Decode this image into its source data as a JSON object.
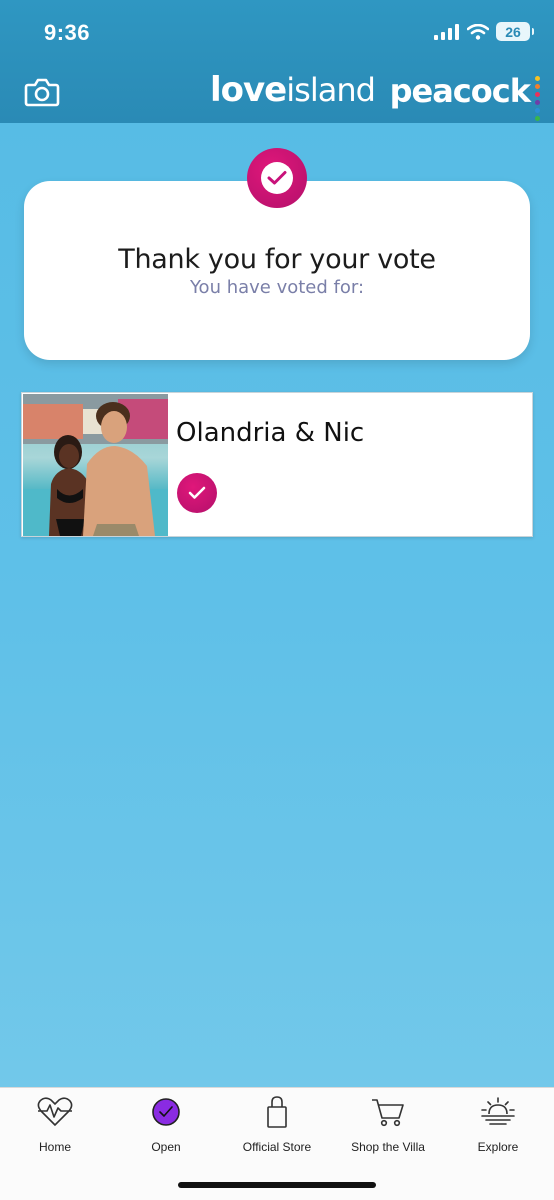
{
  "status_bar": {
    "time": "9:36",
    "battery": "26"
  },
  "header": {
    "logo_love": "love",
    "logo_island": "island",
    "logo_peacock": "peacock",
    "camera_icon": "camera-icon"
  },
  "confirmation": {
    "title": "Thank you for your vote",
    "subtitle": "You have voted for:",
    "badge_icon": "checkmark-icon"
  },
  "voted_couple": {
    "name": "Olandria & Nic",
    "check_icon": "checkmark-icon"
  },
  "tabs": [
    {
      "label": "Home",
      "icon": "heartbeat-icon"
    },
    {
      "label": "Open",
      "icon": "vote-check-icon"
    },
    {
      "label": "Official Store",
      "icon": "shopping-bag-icon"
    },
    {
      "label": "Shop the Villa",
      "icon": "cart-icon"
    },
    {
      "label": "Explore",
      "icon": "sunrise-icon"
    }
  ],
  "colors": {
    "header": "#2a8ab5",
    "background": "#5fc0e8",
    "accent_pink": "#c8117a",
    "open_tab_purple": "#8a2be2"
  }
}
